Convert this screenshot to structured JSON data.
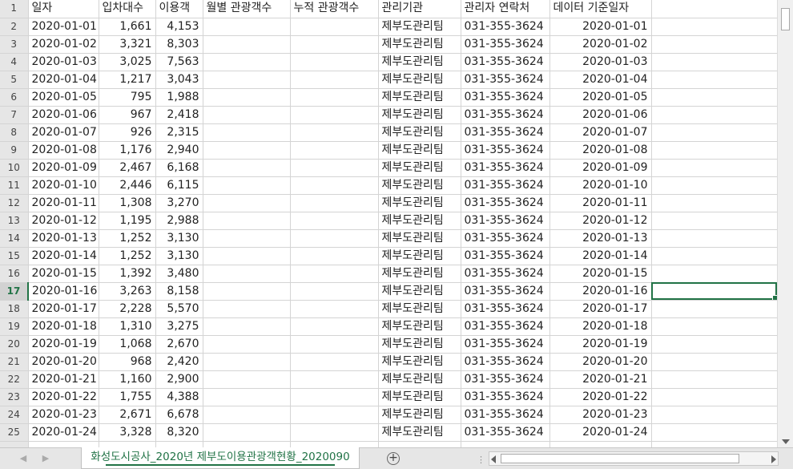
{
  "sheet": {
    "headers": [
      "일자",
      "입차대수",
      "이용객",
      "월별 관광객수",
      "누적 관광객수",
      "관리기관",
      "관리자 연락처",
      "데이터 기준일자",
      ""
    ],
    "rows": [
      [
        "2020-01-01",
        "1,661",
        "4,153",
        "",
        "",
        "제부도관리팀",
        "031-355-3624",
        "2020-01-01",
        ""
      ],
      [
        "2020-01-02",
        "3,321",
        "8,303",
        "",
        "",
        "제부도관리팀",
        "031-355-3624",
        "2020-01-02",
        ""
      ],
      [
        "2020-01-03",
        "3,025",
        "7,563",
        "",
        "",
        "제부도관리팀",
        "031-355-3624",
        "2020-01-03",
        ""
      ],
      [
        "2020-01-04",
        "1,217",
        "3,043",
        "",
        "",
        "제부도관리팀",
        "031-355-3624",
        "2020-01-04",
        ""
      ],
      [
        "2020-01-05",
        "795",
        "1,988",
        "",
        "",
        "제부도관리팀",
        "031-355-3624",
        "2020-01-05",
        ""
      ],
      [
        "2020-01-06",
        "967",
        "2,418",
        "",
        "",
        "제부도관리팀",
        "031-355-3624",
        "2020-01-06",
        ""
      ],
      [
        "2020-01-07",
        "926",
        "2,315",
        "",
        "",
        "제부도관리팀",
        "031-355-3624",
        "2020-01-07",
        ""
      ],
      [
        "2020-01-08",
        "1,176",
        "2,940",
        "",
        "",
        "제부도관리팀",
        "031-355-3624",
        "2020-01-08",
        ""
      ],
      [
        "2020-01-09",
        "2,467",
        "6,168",
        "",
        "",
        "제부도관리팀",
        "031-355-3624",
        "2020-01-09",
        ""
      ],
      [
        "2020-01-10",
        "2,446",
        "6,115",
        "",
        "",
        "제부도관리팀",
        "031-355-3624",
        "2020-01-10",
        ""
      ],
      [
        "2020-01-11",
        "1,308",
        "3,270",
        "",
        "",
        "제부도관리팀",
        "031-355-3624",
        "2020-01-11",
        ""
      ],
      [
        "2020-01-12",
        "1,195",
        "2,988",
        "",
        "",
        "제부도관리팀",
        "031-355-3624",
        "2020-01-12",
        ""
      ],
      [
        "2020-01-13",
        "1,252",
        "3,130",
        "",
        "",
        "제부도관리팀",
        "031-355-3624",
        "2020-01-13",
        ""
      ],
      [
        "2020-01-14",
        "1,252",
        "3,130",
        "",
        "",
        "제부도관리팀",
        "031-355-3624",
        "2020-01-14",
        ""
      ],
      [
        "2020-01-15",
        "1,392",
        "3,480",
        "",
        "",
        "제부도관리팀",
        "031-355-3624",
        "2020-01-15",
        ""
      ],
      [
        "2020-01-16",
        "3,263",
        "8,158",
        "",
        "",
        "제부도관리팀",
        "031-355-3624",
        "2020-01-16",
        ""
      ],
      [
        "2020-01-17",
        "2,228",
        "5,570",
        "",
        "",
        "제부도관리팀",
        "031-355-3624",
        "2020-01-17",
        ""
      ],
      [
        "2020-01-18",
        "1,310",
        "3,275",
        "",
        "",
        "제부도관리팀",
        "031-355-3624",
        "2020-01-18",
        ""
      ],
      [
        "2020-01-19",
        "1,068",
        "2,670",
        "",
        "",
        "제부도관리팀",
        "031-355-3624",
        "2020-01-19",
        ""
      ],
      [
        "2020-01-20",
        "968",
        "2,420",
        "",
        "",
        "제부도관리팀",
        "031-355-3624",
        "2020-01-20",
        ""
      ],
      [
        "2020-01-21",
        "1,160",
        "2,900",
        "",
        "",
        "제부도관리팀",
        "031-355-3624",
        "2020-01-21",
        ""
      ],
      [
        "2020-01-22",
        "1,755",
        "4,388",
        "",
        "",
        "제부도관리팀",
        "031-355-3624",
        "2020-01-22",
        ""
      ],
      [
        "2020-01-23",
        "2,671",
        "6,678",
        "",
        "",
        "제부도관리팀",
        "031-355-3624",
        "2020-01-23",
        ""
      ],
      [
        "2020-01-24",
        "3,328",
        "8,320",
        "",
        "",
        "제부도관리팀",
        "031-355-3624",
        "2020-01-24",
        ""
      ]
    ],
    "row_numbers": [
      "1",
      "2",
      "3",
      "4",
      "5",
      "6",
      "7",
      "8",
      "9",
      "10",
      "11",
      "12",
      "13",
      "14",
      "15",
      "16",
      "17",
      "18",
      "19",
      "20",
      "21",
      "22",
      "23",
      "24",
      "25"
    ],
    "selected_row": "17",
    "active_cell": "I17",
    "accent_color": "#217346"
  },
  "tabs": {
    "prev_icon": "triangle-left-icon",
    "next_icon": "triangle-right-icon",
    "active_sheet": "화성도시공사_2020년 제부도이용관광객현황_2020090",
    "add_sheet_symbol": "+",
    "split_symbol": "⋮"
  },
  "scrollbars": {
    "vertical_down_icon": "arrow-down-icon",
    "horizontal_left_icon": "arrow-left-icon",
    "horizontal_right_icon": "arrow-right-icon"
  }
}
